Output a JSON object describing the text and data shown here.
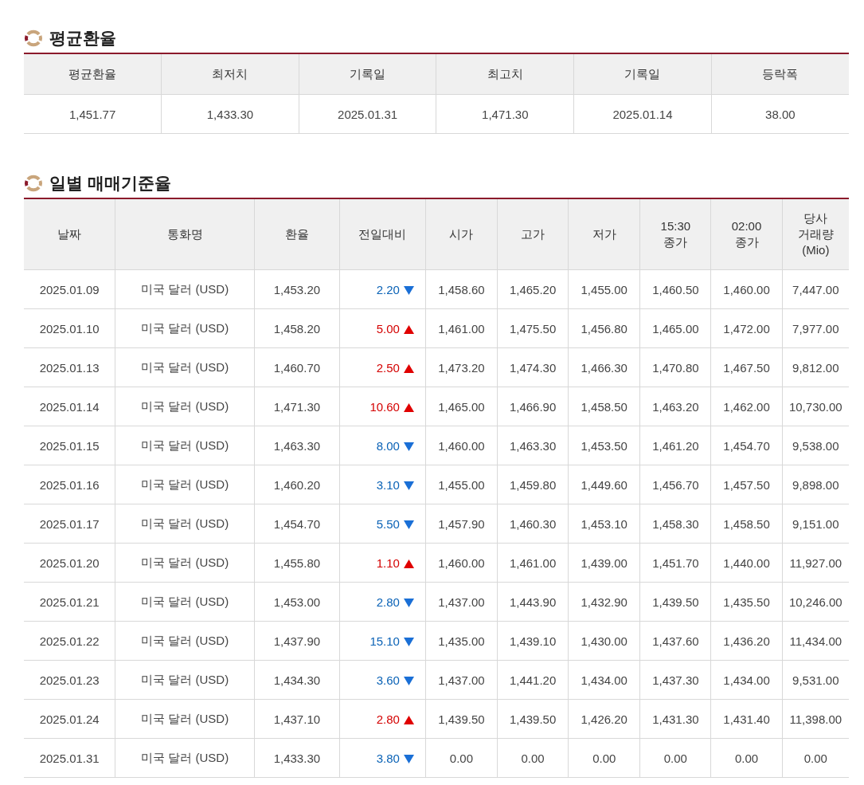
{
  "summary": {
    "title": "평균환율",
    "columns": [
      "평균환율",
      "최저치",
      "기록일",
      "최고치",
      "기록일",
      "등락폭"
    ],
    "values": [
      "1,451.77",
      "1,433.30",
      "2025.01.31",
      "1,471.30",
      "2025.01.14",
      "38.00"
    ]
  },
  "daily": {
    "title": "일별 매매기준율",
    "columns": [
      "날짜",
      "통화명",
      "환율",
      "전일대비",
      "시가",
      "고가",
      "저가",
      "15:30\n종가",
      "02:00\n종가",
      "당사\n거래량\n(Mio)"
    ],
    "rows": [
      {
        "rising": false,
        "cells": [
          "2025.01.09",
          "미국 달러 (USD)",
          "1,453.20",
          "2.20",
          "1,458.60",
          "1,465.20",
          "1,455.00",
          "1,460.50",
          "1,460.00",
          "7,447.00"
        ]
      },
      {
        "rising": true,
        "cells": [
          "2025.01.10",
          "미국 달러 (USD)",
          "1,458.20",
          "5.00",
          "1,461.00",
          "1,475.50",
          "1,456.80",
          "1,465.00",
          "1,472.00",
          "7,977.00"
        ]
      },
      {
        "rising": true,
        "cells": [
          "2025.01.13",
          "미국 달러 (USD)",
          "1,460.70",
          "2.50",
          "1,473.20",
          "1,474.30",
          "1,466.30",
          "1,470.80",
          "1,467.50",
          "9,812.00"
        ]
      },
      {
        "rising": true,
        "cells": [
          "2025.01.14",
          "미국 달러 (USD)",
          "1,471.30",
          "10.60",
          "1,465.00",
          "1,466.90",
          "1,458.50",
          "1,463.20",
          "1,462.00",
          "10,730.00"
        ]
      },
      {
        "rising": false,
        "cells": [
          "2025.01.15",
          "미국 달러 (USD)",
          "1,463.30",
          "8.00",
          "1,460.00",
          "1,463.30",
          "1,453.50",
          "1,461.20",
          "1,454.70",
          "9,538.00"
        ]
      },
      {
        "rising": false,
        "cells": [
          "2025.01.16",
          "미국 달러 (USD)",
          "1,460.20",
          "3.10",
          "1,455.00",
          "1,459.80",
          "1,449.60",
          "1,456.70",
          "1,457.50",
          "9,898.00"
        ]
      },
      {
        "rising": false,
        "cells": [
          "2025.01.17",
          "미국 달러 (USD)",
          "1,454.70",
          "5.50",
          "1,457.90",
          "1,460.30",
          "1,453.10",
          "1,458.30",
          "1,458.50",
          "9,151.00"
        ]
      },
      {
        "rising": true,
        "cells": [
          "2025.01.20",
          "미국 달러 (USD)",
          "1,455.80",
          "1.10",
          "1,460.00",
          "1,461.00",
          "1,439.00",
          "1,451.70",
          "1,440.00",
          "11,927.00"
        ]
      },
      {
        "rising": false,
        "cells": [
          "2025.01.21",
          "미국 달러 (USD)",
          "1,453.00",
          "2.80",
          "1,437.00",
          "1,443.90",
          "1,432.90",
          "1,439.50",
          "1,435.50",
          "10,246.00"
        ]
      },
      {
        "rising": false,
        "cells": [
          "2025.01.22",
          "미국 달러 (USD)",
          "1,437.90",
          "15.10",
          "1,435.00",
          "1,439.10",
          "1,430.00",
          "1,437.60",
          "1,436.20",
          "11,434.00"
        ]
      },
      {
        "rising": false,
        "cells": [
          "2025.01.23",
          "미국 달러 (USD)",
          "1,434.30",
          "3.60",
          "1,437.00",
          "1,441.20",
          "1,434.00",
          "1,437.30",
          "1,434.00",
          "9,531.00"
        ]
      },
      {
        "rising": true,
        "cells": [
          "2025.01.24",
          "미국 달러 (USD)",
          "1,437.10",
          "2.80",
          "1,439.50",
          "1,439.50",
          "1,426.20",
          "1,431.30",
          "1,431.40",
          "11,398.00"
        ]
      },
      {
        "rising": false,
        "cells": [
          "2025.01.31",
          "미국 달러 (USD)",
          "1,433.30",
          "3.80",
          "0.00",
          "0.00",
          "0.00",
          "0.00",
          "0.00",
          "0.00"
        ]
      }
    ]
  }
}
